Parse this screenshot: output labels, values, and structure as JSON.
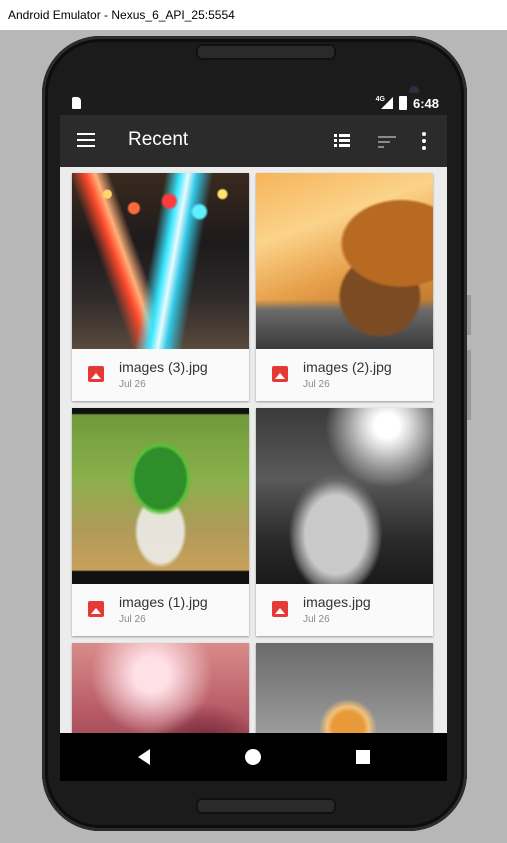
{
  "window": {
    "title": "Android Emulator - Nexus_6_API_25:5554"
  },
  "status_bar": {
    "network": "4G",
    "time": "6:48"
  },
  "app_bar": {
    "title": "Recent",
    "icons": [
      "menu-icon",
      "list-view-icon",
      "sort-icon",
      "more-vert-icon"
    ]
  },
  "files": [
    {
      "name": "images (3).jpg",
      "date": "Jul 26",
      "icon": "image-file-icon"
    },
    {
      "name": "images (2).jpg",
      "date": "Jul 26",
      "icon": "image-file-icon"
    },
    {
      "name": "images (1).jpg",
      "date": "Jul 26",
      "icon": "image-file-icon"
    },
    {
      "name": "images.jpg",
      "date": "Jul 26",
      "icon": "image-file-icon"
    }
  ],
  "nav_bar": {
    "icons": [
      "back-icon",
      "home-icon",
      "recents-icon"
    ]
  },
  "colors": {
    "app_bar": "#2b2b2b",
    "file_icon": "#e53935",
    "background": "#ececec"
  }
}
